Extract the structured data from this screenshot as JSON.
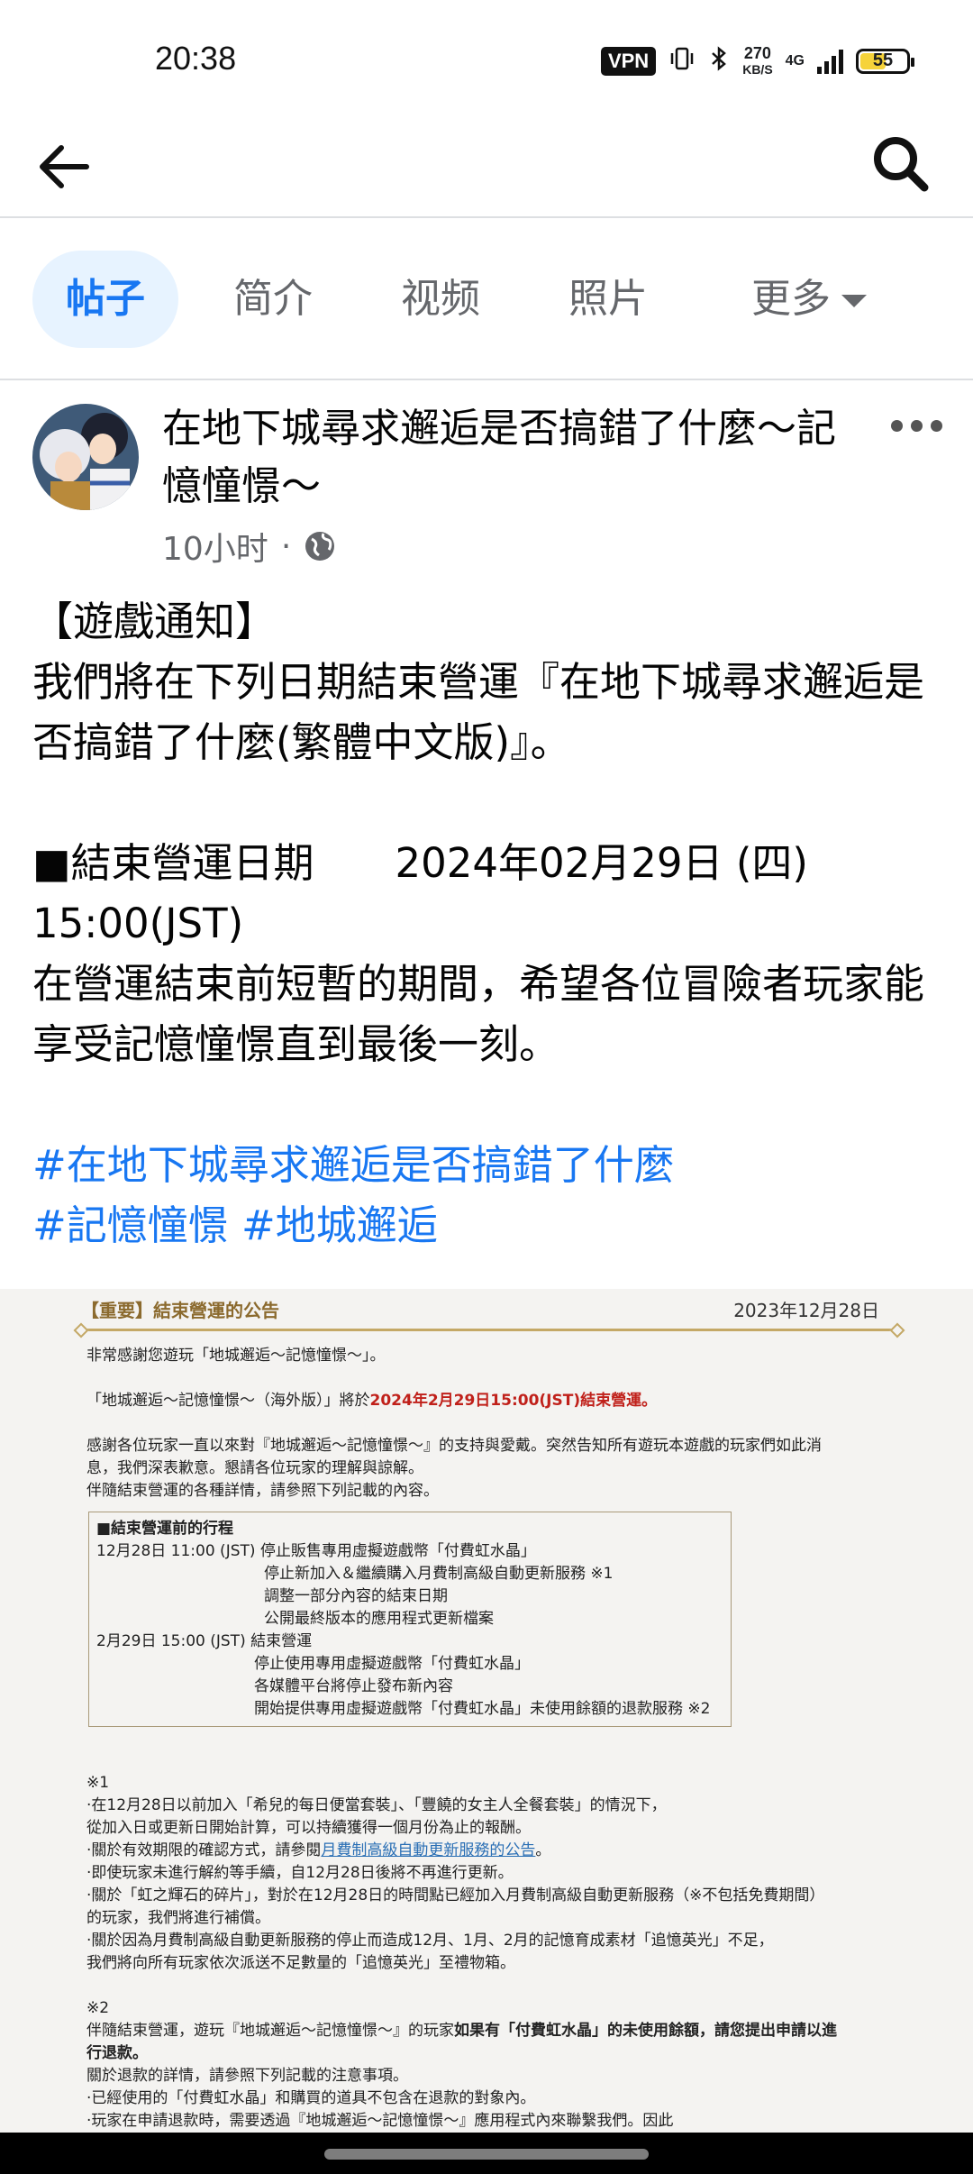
{
  "status_bar": {
    "time": "20:38",
    "vpn": "VPN",
    "speed_value": "270",
    "speed_unit": "KB/S",
    "network": "4G",
    "battery": "55",
    "icons": [
      "vibrate-icon",
      "bluetooth-icon",
      "signal-icon",
      "battery-icon"
    ]
  },
  "top_bar": {
    "back_icon": "arrow-left-icon",
    "search_icon": "search-icon"
  },
  "tabs": [
    {
      "label": "帖子",
      "active": true
    },
    {
      "label": "简介"
    },
    {
      "label": "视频"
    },
    {
      "label": "照片"
    },
    {
      "label": "更多"
    }
  ],
  "post": {
    "page_name": "在地下城尋求邂逅是否搞錯了什麼～記憶憧憬～",
    "time_ago": "10小时",
    "separator": "·",
    "privacy_icon": "globe-icon",
    "lines": {
      "l1": "【遊戲通知】",
      "l2": "我們將在下列日期結束營運『在地下城尋求邂逅是否搞錯了什麼(繁體中文版)』。",
      "l3": "■結束營運日期　　2024年02月29日 (四) 15:00(JST)",
      "l4": "在營運結束前短暫的期間，希望各位冒險者玩家能享受記憶憧憬直到最後一刻。"
    },
    "hashtags": {
      "h1": "#在地下城尋求邂逅是否搞錯了什麼",
      "h2": "#記憶憧憬",
      "h3": "#地城邂逅"
    }
  },
  "notice": {
    "title": "【重要】結束營運的公告",
    "date": "2023年12月28日",
    "p1": "非常感謝您遊玩「地城邂逅～記憶憧憬～」。",
    "p2_a": "「地城邂逅～記憶憧憬～（海外版）」將於",
    "p2_b": "2024年2月29日15:00(JST)結束營運",
    "p2_c": "。",
    "p3_1": "感謝各位玩家一直以來對『地城邂逅～記憶憧憬～』的支持與愛戴。突然告知所有遊玩本遊戲的玩家們如此消",
    "p3_2": "息，我們深表歉意。懇請各位玩家的理解與諒解。",
    "p3_3": "伴隨結束營運的各種詳情，請參照下列記載的內容。",
    "box_title": "■結束營運前的行程",
    "box": {
      "r1": "12月28日 11:00 (JST) 停止販售專用虛擬遊戲幣「付費虹水晶」",
      "r2": "停止新加入＆繼續購入月費制高級自動更新服務 ※1",
      "r3": "調整一部分內容的結束日期",
      "r4": "公開最終版本的應用程式更新檔案",
      "r5": "2月29日 15:00 (JST) 結束營運",
      "r6": "停止使用專用虛擬遊戲幣「付費虹水晶」",
      "r7": "各媒體平台將停止發布新內容",
      "r8": "開始提供專用虛擬遊戲幣「付費虹水晶」未使用餘額的退款服務 ※2"
    },
    "n1": {
      "mark": "※1",
      "l1": "·在12月28日以前加入「希兒的每日便當套裝」、「豐饒的女主人全餐套裝」的情況下，",
      "l2": "從加入日或更新日開始計算，可以持續獲得一個月份為止的報酬。",
      "l3a": "·關於有效期限的確認方式，請參閱",
      "l3b": "月費制高級自動更新服務的公告",
      "l3c": "。",
      "l4": "·即使玩家未進行解約等手續，自12月28日後將不再進行更新。",
      "l5": "·關於「虹之輝石的碎片」，對於在12月28日的時間點已經加入月費制高級自動更新服務（※不包括免費期間）",
      "l6": "的玩家，我們將進行補償。",
      "l7": "·關於因為月費制高級自動更新服務的停止而造成12月、1月、2月的記憶育成素材「追憶英光」不足，",
      "l8": "我們將向所有玩家依次派送不足數量的「追憶英光」至禮物箱。"
    },
    "n2": {
      "mark": "※2",
      "l1a": "伴隨結束營運，遊玩『地城邂逅～記憶憧憬～』的玩家",
      "l1b": "如果有「付費虹水晶」的未使用餘額，請您提出申請以進",
      "l2": "行退款。",
      "l3": "關於退款的詳情，請參照下列記載的注意事項。",
      "l4": "·已經使用的「付費虹水晶」和購買的道具不包含在退款的對象內。",
      "l5": "·玩家在申請退款時，需要透過『地城邂逅～記憶憧憬～』應用程式內來聯繫我們。因此"
    }
  },
  "colors": {
    "accent": "#1877f2",
    "tab_active_bg": "#e7f3ff",
    "notice_gold": "#8b6a2e",
    "notice_red": "#c0201a"
  }
}
